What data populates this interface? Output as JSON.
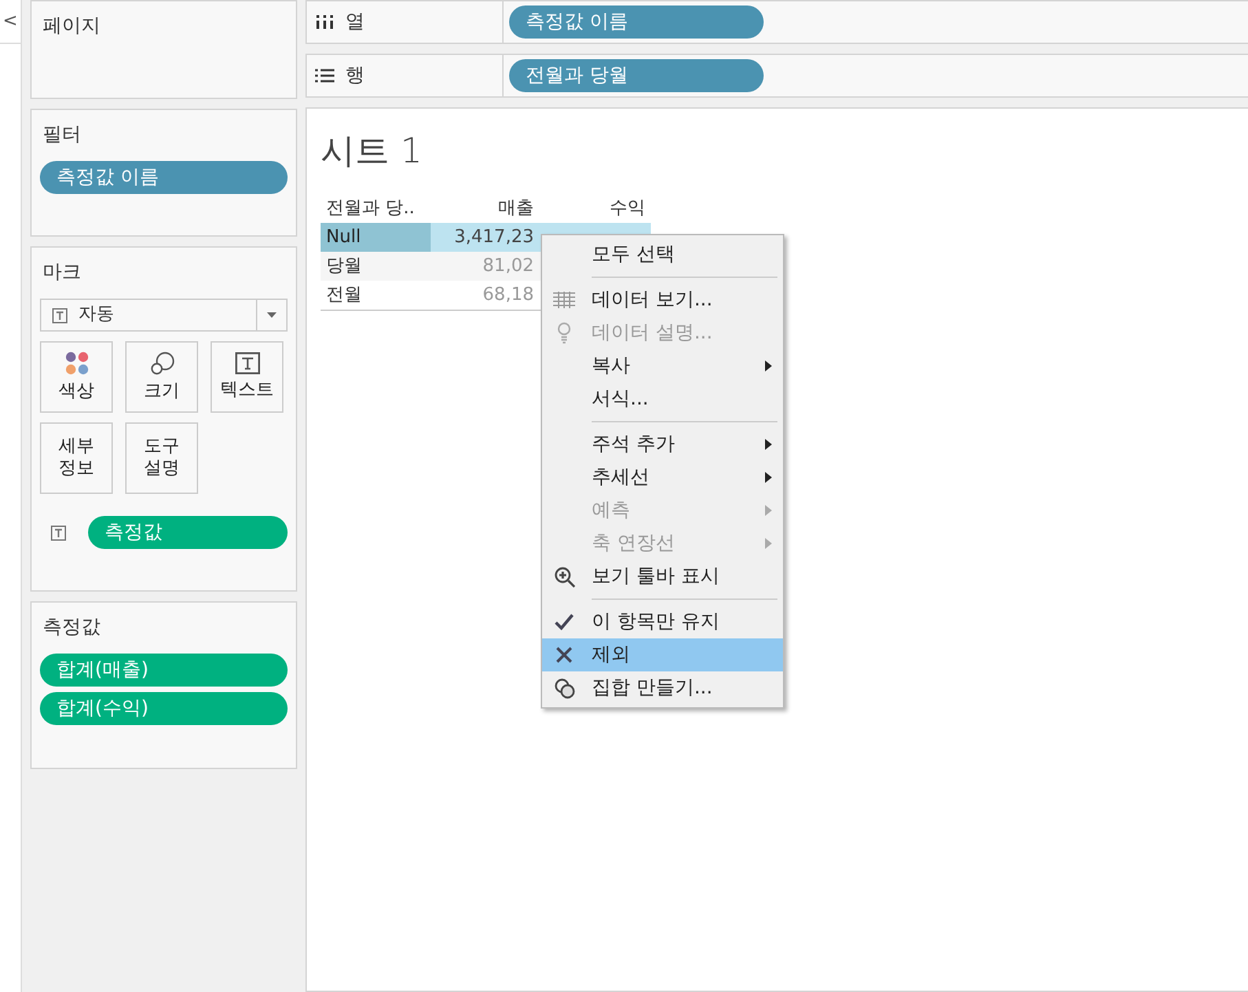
{
  "collapse_button": "<",
  "pages_card": {
    "title": "페이지"
  },
  "filters_card": {
    "title": "필터",
    "pills": [
      "측정값 이름"
    ]
  },
  "marks_card": {
    "title": "마크",
    "mark_type": "자동",
    "buttons": [
      {
        "label": "색상",
        "kind": "color"
      },
      {
        "label": "크기",
        "kind": "size"
      },
      {
        "label": "텍스트",
        "kind": "text"
      },
      {
        "label": "세부\n정보",
        "kind": "detail"
      },
      {
        "label": "도구\n설명",
        "kind": "tooltip"
      }
    ],
    "pill": "측정값"
  },
  "measures_card": {
    "title": "측정값",
    "pills": [
      "합계(매출)",
      "합계(수익)"
    ]
  },
  "shelves": [
    {
      "label": "열",
      "kind": "columns",
      "pill": "측정값 이름"
    },
    {
      "label": "행",
      "kind": "rows",
      "pill": "전월과 당월"
    }
  ],
  "sheet": {
    "title": "시트 1",
    "columns": [
      "전월과 당..",
      "매출",
      "수익"
    ],
    "rows": [
      {
        "cells": [
          "Null",
          "3,417,23"
        ],
        "selected": true
      },
      {
        "cells": [
          "당월",
          "81,02"
        ],
        "selected": false
      },
      {
        "cells": [
          "전월",
          "68,18"
        ],
        "selected": false
      }
    ]
  },
  "context_menu": [
    {
      "kind": "item",
      "label": "모두 선택",
      "disabled": false,
      "submenu": false,
      "selected": false
    },
    {
      "kind": "separator"
    },
    {
      "kind": "item",
      "label": "데이터 보기...",
      "disabled": false,
      "submenu": false,
      "selected": false
    },
    {
      "kind": "item",
      "label": "데이터 설명...",
      "disabled": true,
      "submenu": false,
      "selected": false
    },
    {
      "kind": "item",
      "label": "복사",
      "disabled": false,
      "submenu": true,
      "selected": false
    },
    {
      "kind": "item",
      "label": "서식...",
      "disabled": false,
      "submenu": false,
      "selected": false
    },
    {
      "kind": "separator"
    },
    {
      "kind": "item",
      "label": "주석 추가",
      "disabled": false,
      "submenu": true,
      "selected": false
    },
    {
      "kind": "item",
      "label": "추세선",
      "disabled": false,
      "submenu": true,
      "selected": false
    },
    {
      "kind": "item",
      "label": "예측",
      "disabled": true,
      "submenu": true,
      "selected": false
    },
    {
      "kind": "item",
      "label": "축 연장선",
      "disabled": true,
      "submenu": true,
      "selected": false
    },
    {
      "kind": "item",
      "label": "보기 툴바 표시",
      "disabled": false,
      "submenu": false,
      "selected": false
    },
    {
      "kind": "separator"
    },
    {
      "kind": "item",
      "label": "이 항목만 유지",
      "disabled": false,
      "submenu": false,
      "selected": false
    },
    {
      "kind": "item",
      "label": "제외",
      "disabled": false,
      "submenu": false,
      "selected": true
    },
    {
      "kind": "item",
      "label": "집합 만들기...",
      "disabled": false,
      "submenu": false,
      "selected": false
    }
  ]
}
